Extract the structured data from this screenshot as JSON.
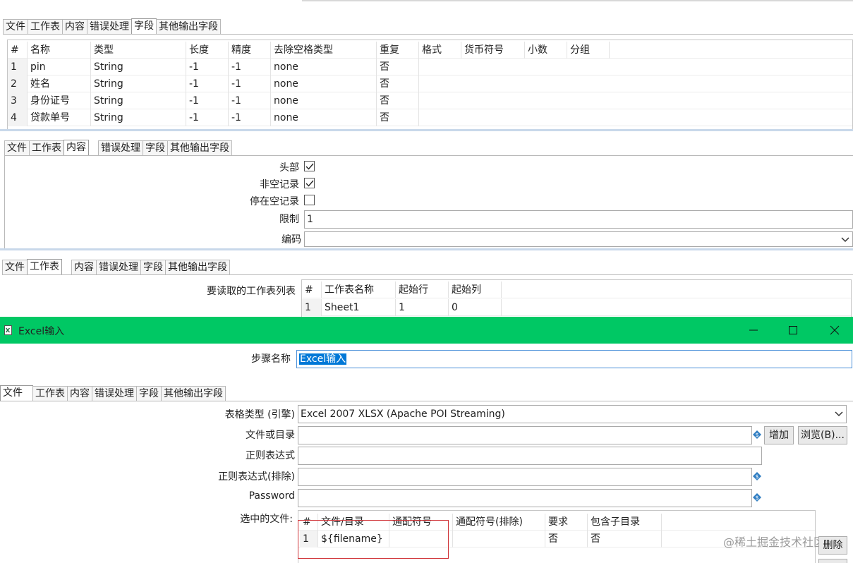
{
  "tabs": [
    "文件",
    "工作表",
    "内容",
    "错误处理",
    "字段",
    "其他输出字段"
  ],
  "fields_grid": {
    "columns": [
      "#",
      "名称",
      "类型",
      "长度",
      "精度",
      "去除空格类型",
      "重复",
      "格式",
      "货币符号",
      "小数",
      "分组"
    ],
    "rows": [
      [
        "1",
        "pin",
        "String",
        "-1",
        "-1",
        "none",
        "否"
      ],
      [
        "2",
        "姓名",
        "String",
        "-1",
        "-1",
        "none",
        "否"
      ],
      [
        "3",
        "身份证号",
        "String",
        "-1",
        "-1",
        "none",
        "否"
      ],
      [
        "4",
        "贷款单号",
        "String",
        "-1",
        "-1",
        "none",
        "否"
      ]
    ]
  },
  "content": {
    "header_label": "头部",
    "header_checked": true,
    "nonempty_label": "非空记录",
    "nonempty_checked": true,
    "stop_empty_label": "停在空记录",
    "stop_empty_checked": false,
    "limit_label": "限制",
    "limit_value": "1",
    "encoding_label": "编码",
    "encoding_value": ""
  },
  "sheets": {
    "label": "要读取的工作表列表",
    "columns": [
      "#",
      "工作表名称",
      "起始行",
      "起始列"
    ],
    "rows": [
      [
        "1",
        "Sheet1",
        "1",
        "0"
      ]
    ]
  },
  "dialog": {
    "title": "Excel输入",
    "title_bg": "#00c864",
    "step_label": "步骤名称",
    "step_value": "Excel输入"
  },
  "file_tab": {
    "spreadsheet_type_label": "表格类型 (引擎)",
    "spreadsheet_type_value": "Excel 2007 XLSX (Apache POI Streaming)",
    "file_or_dir_label": "文件或目录",
    "add_button": "增加",
    "browse_button": "浏览(B)...",
    "regex_label": "正则表达式",
    "regex_exclude_label": "正则表达式(排除)",
    "password_label": "Password",
    "selected_files_label": "选中的文件:",
    "columns": [
      "#",
      "文件/目录",
      "通配符号",
      "通配符号(排除)",
      "要求",
      "包含子目录"
    ],
    "rows": [
      [
        "1",
        "${filename}",
        "",
        "",
        "否",
        "否"
      ]
    ],
    "delete_button": "删除"
  },
  "watermark": "@稀土掘金技术社区",
  "highlight_color": "#d0353a"
}
